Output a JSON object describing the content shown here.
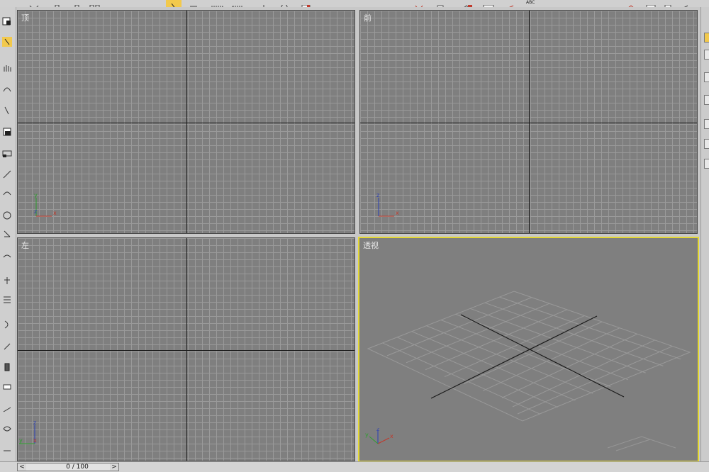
{
  "viewports": {
    "top": {
      "label": "顶"
    },
    "front": {
      "label": "前"
    },
    "left": {
      "label": "左"
    },
    "perspective": {
      "label": "透视",
      "active": true
    }
  },
  "gizmo_axes": {
    "x": "x",
    "y": "y",
    "z": "z"
  },
  "time_slider": {
    "frame_text": "0 / 100",
    "prev_label": "<",
    "next_label": ">"
  },
  "colors": {
    "viewport_bg": "#7f7f7f",
    "grid_line": "#9a9a9a",
    "home_grid_axis": "#1a1a1a",
    "active_border": "#e4d832",
    "x_axis": "#c0392b",
    "y_axis": "#2e9e2e",
    "z_axis": "#2a3fb4"
  },
  "toolbar": {
    "icons": [
      "select-icon",
      "select-region-icon",
      "move-icon",
      "rotate-icon",
      "mirror-icon",
      "align-icon",
      "material-editor-icon",
      "render-icon"
    ],
    "text_badge": "ABC"
  }
}
